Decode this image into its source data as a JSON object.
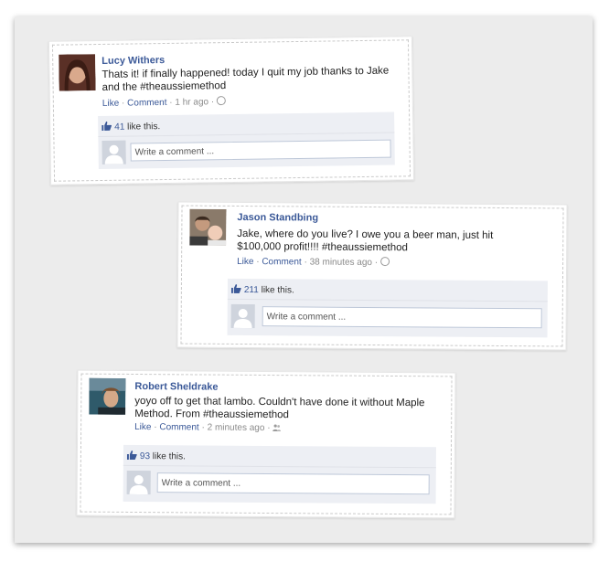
{
  "posts": [
    {
      "author": "Lucy Withers",
      "text": "Thats it! if finally happened! today I quit my job thanks to Jake and the #theaussiemethod",
      "like_label": "Like",
      "comment_label": "Comment",
      "time": "1 hr ago",
      "privacy_icon": "globe-icon",
      "like_count": "41",
      "like_suffix": "like this.",
      "comment_placeholder": "Write a comment ..."
    },
    {
      "author": "Jason Standbing",
      "text": "Jake, where do you live? I owe you a beer man, just hit $100,000 profit!!!! #theaussiemethod",
      "like_label": "Like",
      "comment_label": "Comment",
      "time": "38 minutes ago",
      "privacy_icon": "globe-icon",
      "like_count": "211",
      "like_suffix": "like this.",
      "comment_placeholder": "Write a comment ..."
    },
    {
      "author": "Robert Sheldrake",
      "text": "yoyo off to get that lambo. Couldn't have done it without Maple Method. From #theaussiemethod",
      "like_label": "Like",
      "comment_label": "Comment",
      "time": "2 minutes ago",
      "privacy_icon": "friends-icon",
      "like_count": "93",
      "like_suffix": "like this.",
      "comment_placeholder": "Write a comment ..."
    }
  ],
  "colors": {
    "link": "#3b5998",
    "ufi_bg": "#edeff4",
    "frame_bg": "#ececec"
  }
}
